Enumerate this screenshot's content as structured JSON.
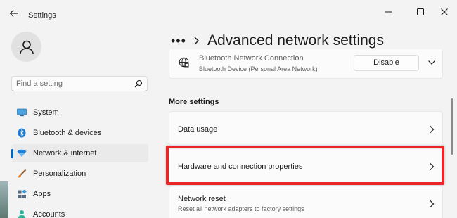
{
  "window": {
    "title": "Settings",
    "controls": {
      "minimize": "minimize",
      "maximize": "maximize",
      "close": "close"
    }
  },
  "search": {
    "placeholder": "Find a setting"
  },
  "nav": {
    "items": [
      {
        "label": "System",
        "icon": "monitor-icon",
        "active": false
      },
      {
        "label": "Bluetooth & devices",
        "icon": "bluetooth-icon",
        "active": false
      },
      {
        "label": "Network & internet",
        "icon": "wifi-icon",
        "active": true
      },
      {
        "label": "Personalization",
        "icon": "brush-icon",
        "active": false
      },
      {
        "label": "Apps",
        "icon": "apps-icon",
        "active": false
      },
      {
        "label": "Accounts",
        "icon": "person-icon",
        "active": false
      }
    ]
  },
  "header": {
    "breadcrumb_overflow": "•••",
    "title": "Advanced network settings"
  },
  "adapter": {
    "name": "Bluetooth Network Connection",
    "description": "Bluetooth Device (Personal Area Network)",
    "button_label": "Disable"
  },
  "more_settings": {
    "heading": "More settings",
    "items": [
      {
        "title": "Data usage",
        "subtitle": ""
      },
      {
        "title": "Hardware and connection properties",
        "subtitle": ""
      },
      {
        "title": "Network reset",
        "subtitle": "Reset all network adapters to factory settings"
      }
    ]
  },
  "colors": {
    "accent": "#0067c0",
    "highlight_box": "#e8262a",
    "background": "#f3f3f3",
    "card": "#fbfbfb"
  }
}
